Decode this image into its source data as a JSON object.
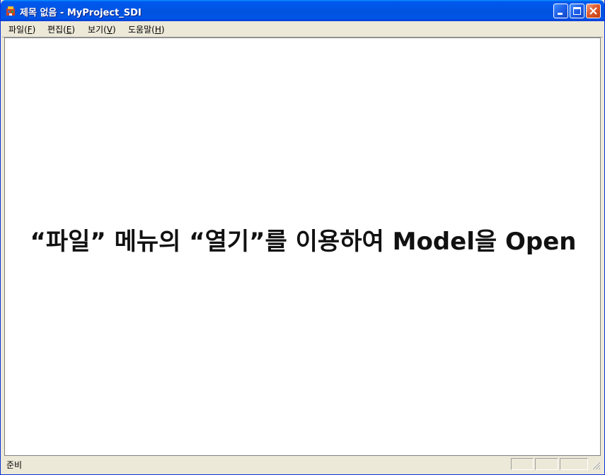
{
  "window": {
    "title": "제목 없음 - MyProject_SDI",
    "accent_color": "#0055e5",
    "close_color": "#e05a2c"
  },
  "titlebar": {
    "app_icon": "app-icon",
    "buttons": {
      "minimize": "minimize-icon",
      "maximize": "maximize-icon",
      "close": "close-icon"
    }
  },
  "menu": {
    "items": [
      {
        "label": "파일(",
        "hotkey": "F",
        "suffix": ")"
      },
      {
        "label": "편집(",
        "hotkey": "E",
        "suffix": ")"
      },
      {
        "label": "보기(",
        "hotkey": "V",
        "suffix": ")"
      },
      {
        "label": "도움말(",
        "hotkey": "H",
        "suffix": ")"
      }
    ]
  },
  "main": {
    "instruction": "“파일” 메뉴의 “열기”를 이용하여 Model을 Open"
  },
  "status": {
    "text": "준비"
  }
}
